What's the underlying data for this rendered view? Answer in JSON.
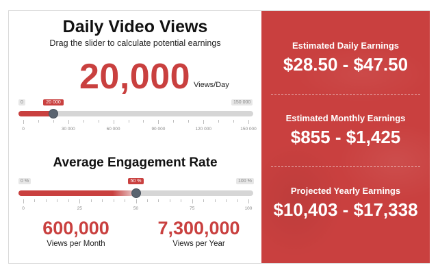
{
  "views": {
    "title": "Daily Video Views",
    "subtitle": "Drag the slider to calculate potential earnings",
    "value": "20,000",
    "unit": "Views/Day",
    "slider": {
      "min_label": "0",
      "max_label": "150 000",
      "bubble": "20 000",
      "fraction": 0.1333,
      "tick_labels": [
        "0",
        "30 000",
        "60 000",
        "90 000",
        "120 000",
        "150 000"
      ]
    }
  },
  "engagement": {
    "title": "Average Engagement Rate",
    "slider": {
      "min_label": "0 %",
      "max_label": "100 %",
      "bubble": "50 %",
      "fraction": 0.5,
      "tick_labels": [
        "0",
        "25",
        "50",
        "75",
        "100"
      ]
    }
  },
  "stats": {
    "month": {
      "value": "600,000",
      "label": "Views per Month"
    },
    "year": {
      "value": "7,300,000",
      "label": "Views per Year"
    }
  },
  "earnings": {
    "daily": {
      "heading": "Estimated Daily Earnings",
      "value": "$28.50 - $47.50"
    },
    "monthly": {
      "heading": "Estimated Monthly Earnings",
      "value": "$855 - $1,425"
    },
    "yearly": {
      "heading": "Projected Yearly Earnings",
      "value": "$10,403 - $17,338"
    }
  },
  "colors": {
    "accent": "#c9403f",
    "knob": "#5a6470",
    "track": "#d6d6d6"
  }
}
